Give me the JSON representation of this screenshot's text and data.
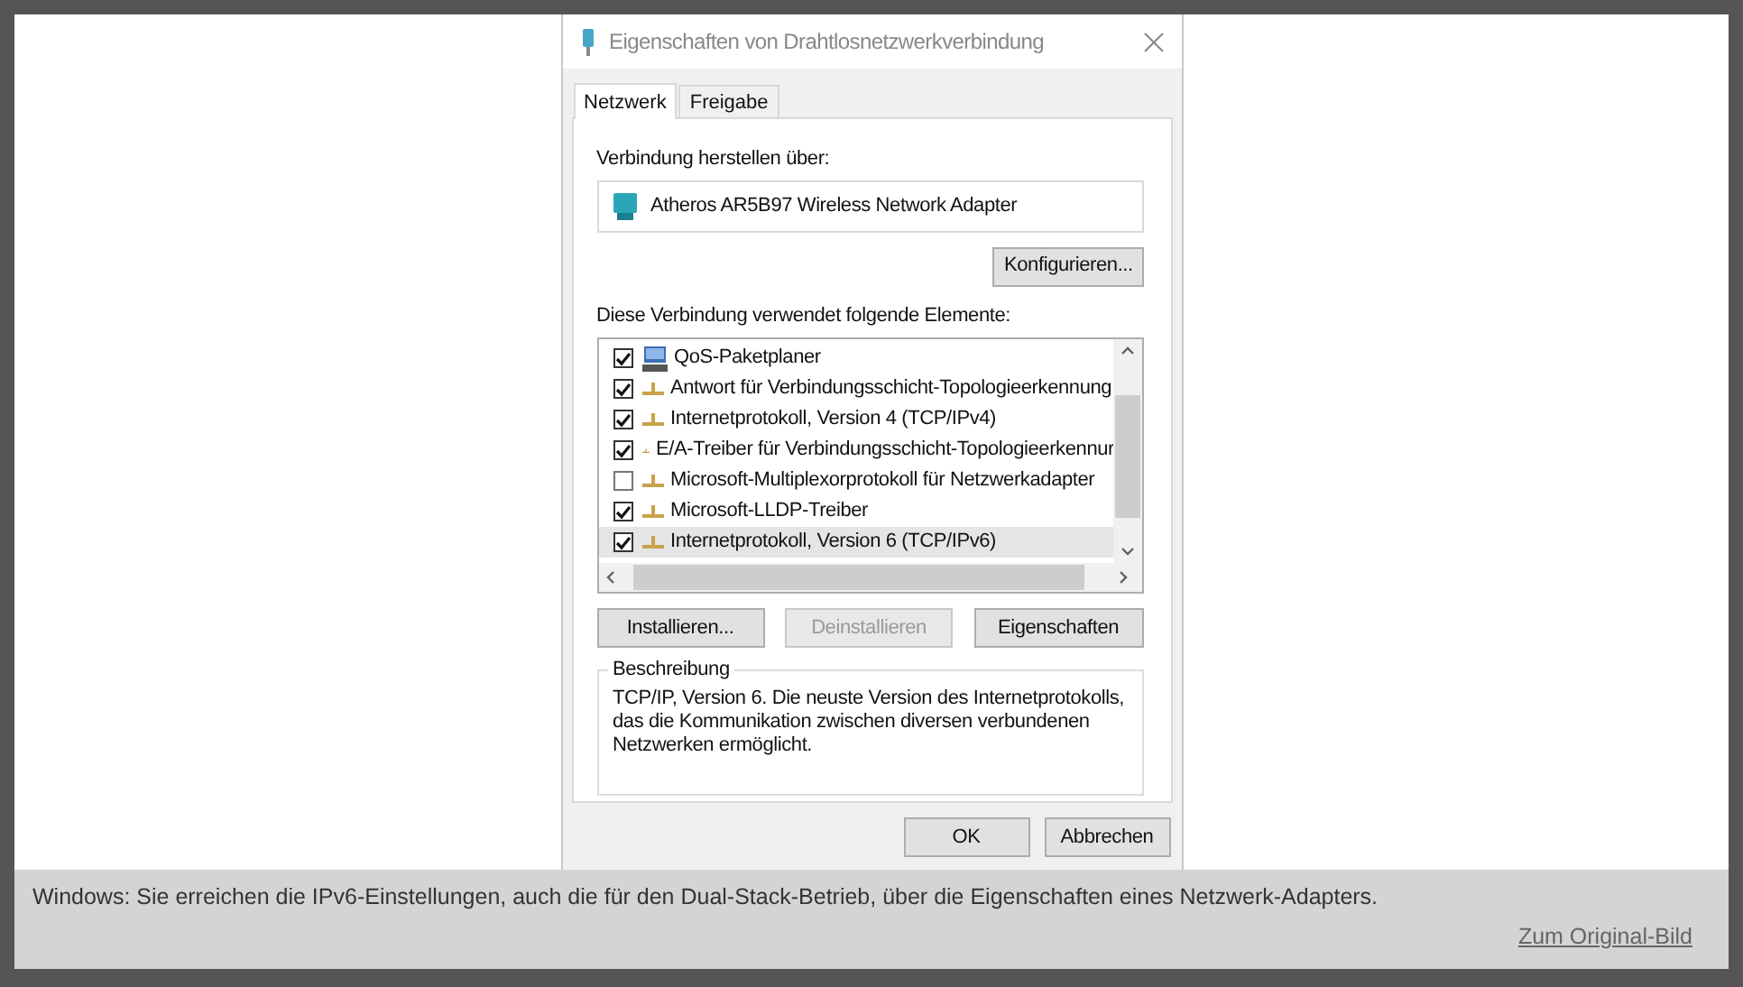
{
  "dialog": {
    "title": "Eigenschaften von Drahtlosnetzwerkverbindung",
    "tabs": [
      {
        "label": "Netzwerk",
        "selected": true
      },
      {
        "label": "Freigabe",
        "selected": false
      }
    ],
    "connect_label": "Verbindung herstellen über:",
    "adapter": "Atheros AR5B97 Wireless Network Adapter",
    "configure_button": "Konfigurieren...",
    "elements_label": "Diese Verbindung verwendet folgende Elemente:",
    "elements": [
      {
        "kind": "service",
        "label": "QoS-Paketplaner",
        "checked": true,
        "selected": false
      },
      {
        "kind": "protocol",
        "label": "Antwort für Verbindungsschicht-Topologieerkennung",
        "checked": true,
        "selected": false
      },
      {
        "kind": "protocol",
        "label": "Internetprotokoll, Version 4 (TCP/IPv4)",
        "checked": true,
        "selected": false
      },
      {
        "kind": "protocol",
        "label": "E/A-Treiber für Verbindungsschicht-Topologieerkennur",
        "checked": true,
        "selected": false
      },
      {
        "kind": "protocol",
        "label": "Microsoft-Multiplexorprotokoll für Netzwerkadapter",
        "checked": false,
        "selected": false
      },
      {
        "kind": "protocol",
        "label": "Microsoft-LLDP-Treiber",
        "checked": true,
        "selected": false
      },
      {
        "kind": "protocol",
        "label": "Internetprotokoll, Version 6 (TCP/IPv6)",
        "checked": true,
        "selected": true
      }
    ],
    "action_buttons": [
      {
        "label": "Installieren...",
        "disabled": false
      },
      {
        "label": "Deinstallieren",
        "disabled": true
      },
      {
        "label": "Eigenschaften",
        "disabled": false
      }
    ],
    "description": {
      "legend": "Beschreibung",
      "text": "TCP/IP, Version 6. Die neuste Version des Internetprotokolls, das die Kommunikation zwischen diversen verbundenen Netzwerken ermöglicht."
    },
    "footer_buttons": [
      "OK",
      "Abbrechen"
    ]
  },
  "caption": {
    "text": "Windows: Sie erreichen die IPv6-Einstellungen, auch die für den Dual-Stack-Betrieb, über die Eigenschaften eines Netzwerk-Adapters.",
    "link": "Zum Original-Bild"
  }
}
